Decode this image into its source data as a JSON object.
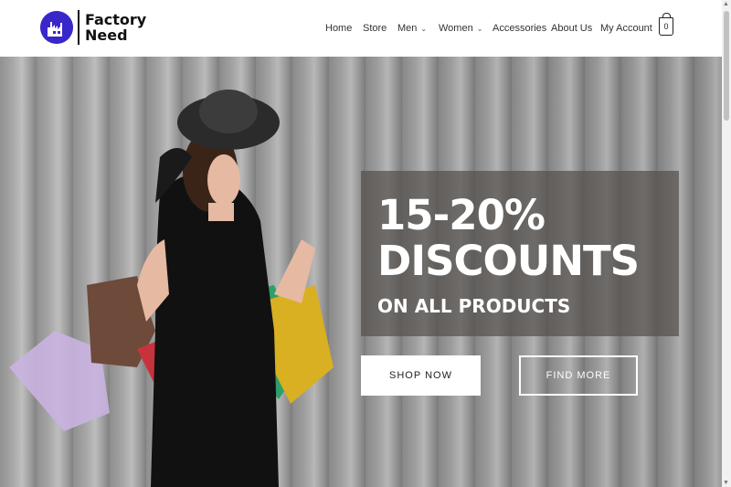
{
  "logo": {
    "line1": "Factory",
    "line2": "Need"
  },
  "nav": {
    "items": [
      {
        "label": "Home",
        "has_dropdown": false
      },
      {
        "label": "Store",
        "has_dropdown": false
      },
      {
        "label": "Men",
        "has_dropdown": true
      },
      {
        "label": "Women",
        "has_dropdown": true
      },
      {
        "label": "Accessories",
        "has_dropdown": false
      },
      {
        "label": "About Us",
        "has_dropdown": false
      },
      {
        "label": "My Account",
        "has_dropdown": false
      }
    ],
    "cart_count": "0"
  },
  "hero": {
    "headline_line1": "15-20%",
    "headline_line2": "DISCOUNTS",
    "subheadline": "ON ALL PRODUCTS",
    "primary_button": "SHOP NOW",
    "secondary_button": "FIND MORE"
  },
  "colors": {
    "brand": "#3a27c9",
    "overlay": "#55504e"
  }
}
